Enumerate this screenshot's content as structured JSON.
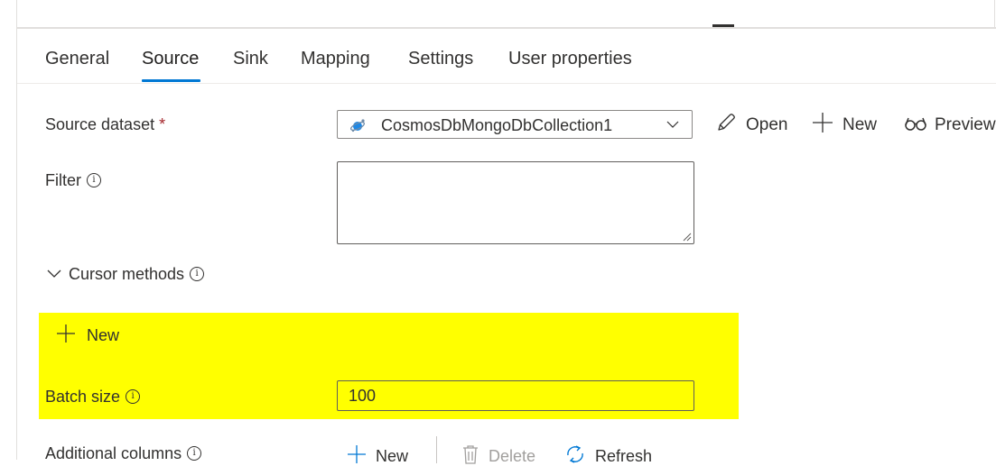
{
  "tabs": [
    {
      "label": "General"
    },
    {
      "label": "Source"
    },
    {
      "label": "Sink"
    },
    {
      "label": "Mapping"
    },
    {
      "label": "Settings"
    },
    {
      "label": "User properties"
    }
  ],
  "active_tab": "Source",
  "source_dataset": {
    "label": "Source dataset",
    "required_marker": "*",
    "selected": "CosmosDbMongoDbCollection1",
    "actions": {
      "open": "Open",
      "new": "New",
      "preview": "Preview"
    }
  },
  "filter": {
    "label": "Filter",
    "value": ""
  },
  "cursor_methods": {
    "label": "Cursor methods",
    "new_label": "New"
  },
  "batch_size": {
    "label": "Batch size",
    "value": "100"
  },
  "additional_columns": {
    "label": "Additional columns",
    "new_label": "New",
    "delete_label": "Delete",
    "refresh_label": "Refresh"
  },
  "colors": {
    "accent": "#0078d4",
    "highlight": "#ffff00",
    "required": "#a4262c"
  }
}
